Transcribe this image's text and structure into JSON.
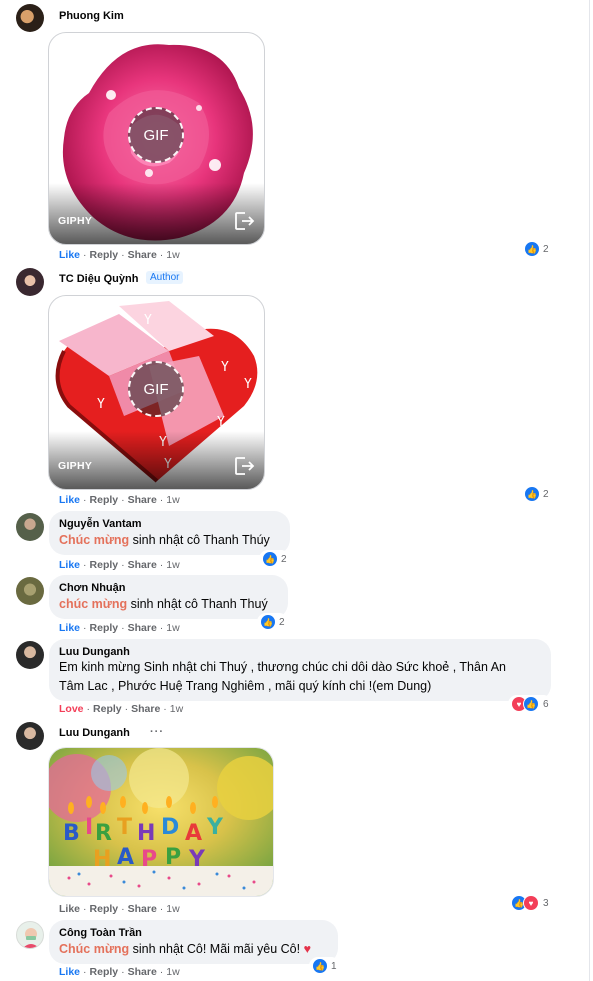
{
  "actions": {
    "like": "Like",
    "reply": "Reply",
    "share": "Share",
    "love": "Love",
    "sep": "·"
  },
  "gif": {
    "provider": "GIPHY",
    "badge": "GIF"
  },
  "colors": {
    "like": "#1877f2",
    "love": "#f33e58",
    "tag": "#e4715b"
  },
  "comments": [
    {
      "name": "Phuong Kim",
      "time": "1w",
      "reaction_count": "2",
      "reactions": [
        "like-icon"
      ]
    },
    {
      "name": "TC Diệu Quỳnh",
      "badge": "Author",
      "time": "1w",
      "reaction_count": "2",
      "reactions": [
        "like-icon"
      ]
    },
    {
      "name": "Nguyễn Vantam",
      "tag": "Chúc mừng",
      "text": " sinh nhật cô Thanh Thúy",
      "time": "1w",
      "reaction_count": "2",
      "reactions": [
        "like-icon"
      ]
    },
    {
      "name": "Chơn Nhuận",
      "tag": "chúc mừng",
      "text": " sinh nhật cô Thanh Thuý",
      "time": "1w",
      "reaction_count": "2",
      "reactions": [
        "like-icon"
      ]
    },
    {
      "name": "Luu Dunganh",
      "text1": "Em kinh mừng Sinh nhật chi Thuý , thương chúc chi dôi dào Sức khoẻ , Thân An",
      "text2": "Tâm Lac , Phước Huệ Trang Nghiêm , mãi quý kính chi !(em Dung)",
      "time": "1w",
      "reaction_count": "6",
      "reactions": [
        "love-icon",
        "like-icon"
      ]
    },
    {
      "name": "Luu Dunganh",
      "more": "···",
      "time": "1w",
      "reaction_count": "3",
      "reactions": [
        "like-icon",
        "love-icon"
      ]
    },
    {
      "name": "Công Toàn Trần",
      "tag": "Chúc mừng",
      "text": " sinh nhật Cô! Mãi mãi yêu Cô! ",
      "heart": "♥",
      "time": "1w",
      "reaction_count": "1",
      "reactions": [
        "like-icon"
      ]
    }
  ]
}
